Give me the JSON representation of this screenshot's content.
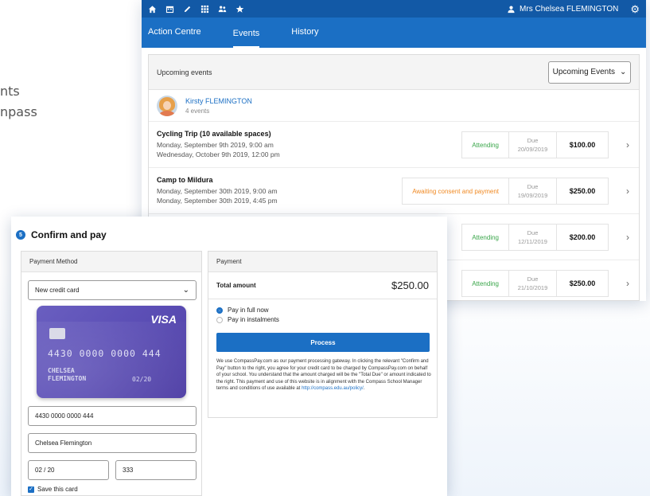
{
  "side_text": [
    "nts",
    "npass"
  ],
  "topbar": {
    "icons": [
      "home-icon",
      "calendar-icon",
      "pencil-icon",
      "grid-icon",
      "people-icon",
      "star-icon"
    ],
    "user_name": "Mrs Chelsea FLEMINGTON",
    "user_icon": "user-icon",
    "settings_icon": "gear-icon"
  },
  "nav": {
    "tabs": [
      {
        "label": "Action Centre",
        "active": false
      },
      {
        "label": "Events",
        "active": true
      },
      {
        "label": "History",
        "active": false
      }
    ]
  },
  "events": {
    "header": "Upcoming events",
    "filter_value": "Upcoming Events",
    "person": {
      "name": "Kirsty FLEMINGTON",
      "count": "4 events"
    },
    "rows": [
      {
        "title": "Cycling Trip (10 available spaces)",
        "line1": "Monday, September 9th 2019, 9:00 am",
        "line2": "Wednesday, October 9th 2019, 12:00 pm",
        "status": "Attending",
        "status_color": "#3aa64a",
        "due_label": "Due",
        "due_date": "20/09/2019",
        "amount": "$100.00"
      },
      {
        "title": "Camp to Mildura",
        "line1": "Monday, September 30th 2019, 9:00 am",
        "line2": "Monday, September 30th 2019, 4:45 pm",
        "status": "Awaiting consent and payment",
        "status_color": "#f08a24",
        "due_label": "Due",
        "due_date": "19/09/2019",
        "amount": "$250.00"
      },
      {
        "title": "",
        "line1": "",
        "line2": "",
        "status": "Attending",
        "status_color": "#3aa64a",
        "due_label": "Due",
        "due_date": "12/11/2019",
        "amount": "$200.00"
      },
      {
        "title": "",
        "line1": "",
        "line2": "",
        "status": "Attending",
        "status_color": "#3aa64a",
        "due_label": "Due",
        "due_date": "21/10/2019",
        "amount": "$250.00"
      }
    ]
  },
  "confirm": {
    "step": "5",
    "title": "Confirm and pay",
    "method_header": "Payment Method",
    "method_select": "New credit card",
    "card": {
      "brand": "VISA",
      "number": "4430 0000 0000 444",
      "holder_line1": "CHELSEA",
      "holder_line2": "FLEMINGTON",
      "expiry": "02/20"
    },
    "card_number_value": "4430 0000 0000 444",
    "name_value": "Chelsea Flemington",
    "expiry_value": "02 / 20",
    "cvv_value": "333",
    "save_label": "Save this card",
    "payment_header": "Payment",
    "total_label": "Total amount",
    "total_value": "$250.00",
    "options": [
      {
        "label": "Pay in full now",
        "selected": true
      },
      {
        "label": "Pay in instalments",
        "selected": false
      }
    ],
    "process_label": "Process",
    "legal_text": "We use CompassPay.com as our payment processing gateway. In clicking the relevant \"Confirm and Pay\" button to the right, you agree for your credit card to be charged by CompassPay.com on behalf of your school. You understand that the amount charged will be the \"Total Due\" or amount indicated to the right. This payment and use of this website is in alignment with the Compass School Manager terms and conditions of use available at",
    "legal_link": "http://compass.edu.au/policy/",
    "legal_end": "."
  }
}
